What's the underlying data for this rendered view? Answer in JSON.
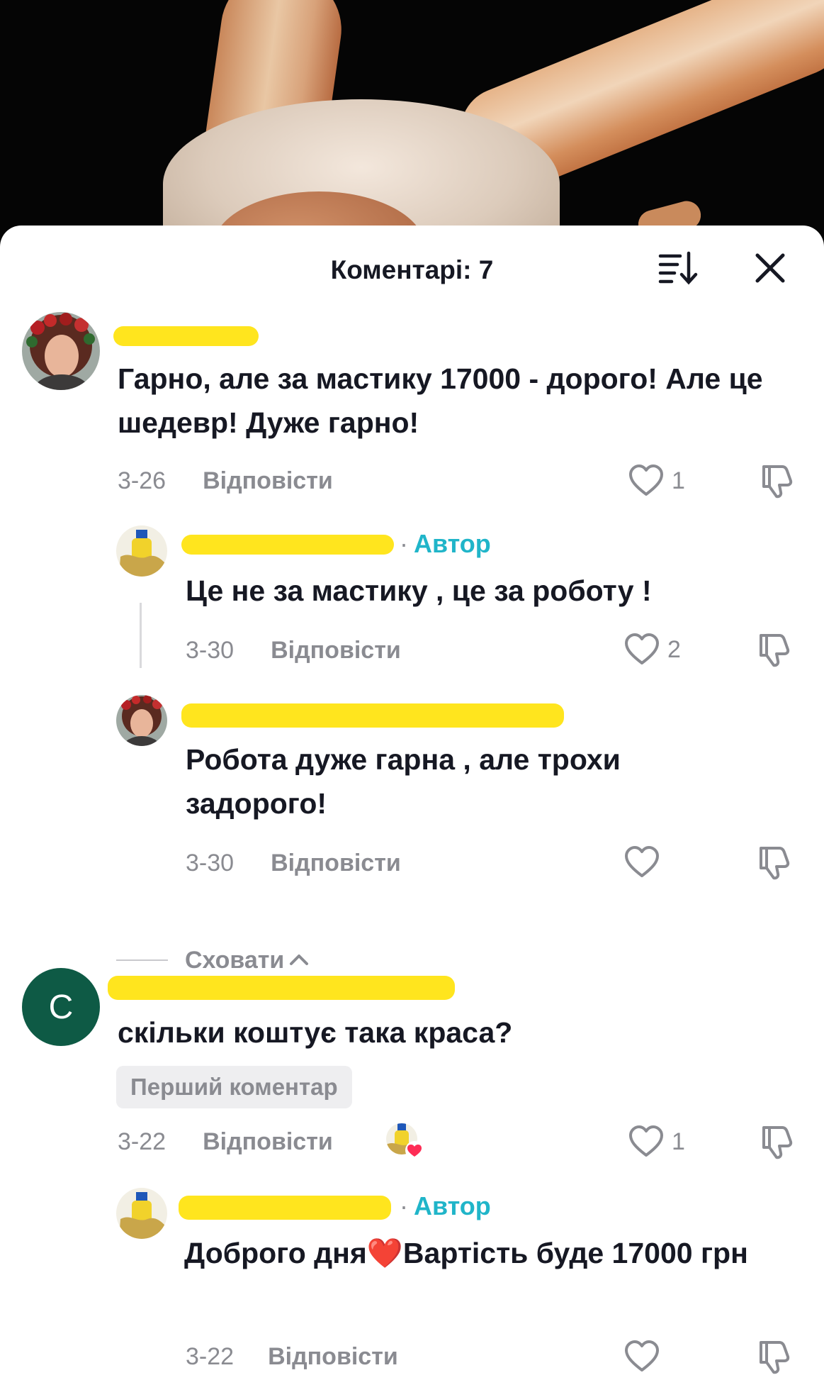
{
  "header": {
    "title": "Коментарі: 7",
    "sort_icon": "sort-icon",
    "close_icon": "close-icon"
  },
  "comments": [
    {
      "avatar": "avatar-photo-woman-wreath",
      "text": "Гарно, але за мастику 17000 - дорого! Але це шедевр! Дуже гарно!",
      "date": "3-26",
      "reply": "Відповісти",
      "likes": "1"
    },
    {
      "avatar": "avatar-photo-flag",
      "author_tag": "Автор",
      "text": "Це не за мастику , це за роботу !",
      "date": "3-30",
      "reply": "Відповісти",
      "likes": "2"
    },
    {
      "avatar": "avatar-photo-woman-wreath",
      "text": "Робота дуже гарна , але трохи задорого!",
      "date": "3-30",
      "reply": "Відповісти",
      "likes": ""
    },
    {
      "avatar_letter": "С",
      "text": "скільки коштує така краса?",
      "badge": "Перший коментар",
      "date": "3-22",
      "reply": "Відповісти",
      "likes": "1"
    },
    {
      "avatar": "avatar-photo-flag",
      "author_tag": "Автор",
      "text": "Доброго дня❤️Вартість буде 17000 грн",
      "date": "3-22",
      "reply": "Відповісти",
      "likes": ""
    }
  ],
  "hide_replies": "Сховати",
  "colors": {
    "author_tag": "#20b5c9",
    "redaction": "#ffe417",
    "avatar_letter_bg": "#0e5a45",
    "heart_badge": "#fe2c55"
  }
}
